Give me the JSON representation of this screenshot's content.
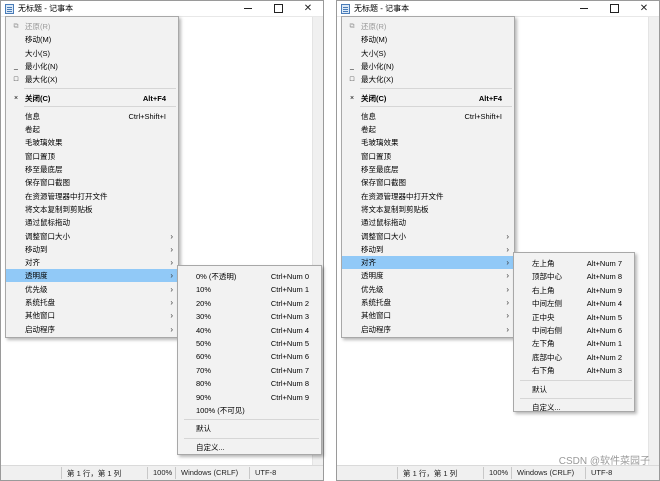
{
  "window": {
    "title": "无标题 - 记事本",
    "status": {
      "position": "第 1 行，第 1 列",
      "zoom": "100%",
      "line_ending": "Windows (CRLF)",
      "encoding": "UTF-8"
    }
  },
  "system_menu": {
    "items": [
      {
        "label": "还原(R)",
        "icon": "restore-icon",
        "glyph": "⧉",
        "disabled": true
      },
      {
        "label": "移动(M)"
      },
      {
        "label": "大小(S)"
      },
      {
        "label": "最小化(N)",
        "icon": "minimize-icon",
        "glyph": "_"
      },
      {
        "label": "最大化(X)",
        "icon": "maximize-icon",
        "glyph": "□"
      },
      {
        "label": "关闭(C)",
        "shortcut": "Alt+F4",
        "icon": "close-icon",
        "glyph": "×",
        "bold": true
      },
      {
        "label": "信息",
        "shortcut": "Ctrl+Shift+I"
      },
      {
        "label": "卷起"
      },
      {
        "label": "毛玻璃效果"
      },
      {
        "label": "窗口置顶"
      },
      {
        "label": "移至最底层"
      },
      {
        "label": "保存窗口截图"
      },
      {
        "label": "在资源管理器中打开文件"
      },
      {
        "label": "将文本复制到剪贴板"
      },
      {
        "label": "通过鼠标拖动"
      },
      {
        "label": "调整窗口大小",
        "submenu": true
      },
      {
        "label": "移动到",
        "submenu": true
      },
      {
        "label": "对齐",
        "submenu": true
      },
      {
        "label": "透明度",
        "submenu": true
      },
      {
        "label": "优先级",
        "submenu": true
      },
      {
        "label": "系统托盘",
        "submenu": true
      },
      {
        "label": "其他窗口",
        "submenu": true
      },
      {
        "label": "启动程序",
        "submenu": true
      }
    ]
  },
  "transparency_menu": {
    "items": [
      {
        "label": "0% (不透明)",
        "shortcut": "Ctrl+Num 0"
      },
      {
        "label": "10%",
        "shortcut": "Ctrl+Num 1"
      },
      {
        "label": "20%",
        "shortcut": "Ctrl+Num 2"
      },
      {
        "label": "30%",
        "shortcut": "Ctrl+Num 3"
      },
      {
        "label": "40%",
        "shortcut": "Ctrl+Num 4"
      },
      {
        "label": "50%",
        "shortcut": "Ctrl+Num 5"
      },
      {
        "label": "60%",
        "shortcut": "Ctrl+Num 6"
      },
      {
        "label": "70%",
        "shortcut": "Ctrl+Num 7"
      },
      {
        "label": "80%",
        "shortcut": "Ctrl+Num 8"
      },
      {
        "label": "90%",
        "shortcut": "Ctrl+Num 9"
      },
      {
        "label": "100% (不可见)",
        "shortcut": ""
      },
      {
        "label": "默认",
        "shortcut": ""
      },
      {
        "label": "自定义...",
        "shortcut": ""
      }
    ]
  },
  "align_menu": {
    "items": [
      {
        "label": "左上角",
        "shortcut": "Alt+Num 7"
      },
      {
        "label": "顶部中心",
        "shortcut": "Alt+Num 8"
      },
      {
        "label": "右上角",
        "shortcut": "Alt+Num 9"
      },
      {
        "label": "中间左侧",
        "shortcut": "Alt+Num 4"
      },
      {
        "label": "正中央",
        "shortcut": "Alt+Num 5"
      },
      {
        "label": "中间右侧",
        "shortcut": "Alt+Num 6"
      },
      {
        "label": "左下角",
        "shortcut": "Alt+Num 1"
      },
      {
        "label": "底部中心",
        "shortcut": "Alt+Num 2"
      },
      {
        "label": "右下角",
        "shortcut": "Alt+Num 3"
      },
      {
        "label": "默认",
        "shortcut": ""
      },
      {
        "label": "自定义...",
        "shortcut": ""
      }
    ]
  },
  "watermark": "CSDN @软件菜园子",
  "colors": {
    "menu_bg": "#f2f2f2",
    "highlight": "#91c9f7"
  }
}
